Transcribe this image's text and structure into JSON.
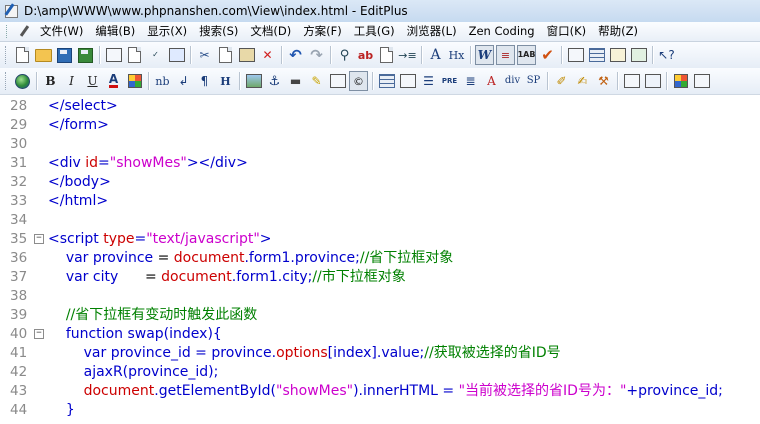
{
  "window": {
    "title": "D:\\amp\\WWW\\www.phpnanshen.com\\View\\index.html - EditPlus"
  },
  "menu": [
    "文件(W)",
    "编辑(B)",
    "显示(X)",
    "搜索(S)",
    "文档(D)",
    "方案(F)",
    "工具(G)",
    "浏览器(L)",
    "Zen Coding",
    "窗口(K)",
    "帮助(Z)"
  ],
  "toolbar2_text": {
    "bold": "B",
    "italic": "I",
    "underline": "U",
    "font_color": "A",
    "nbsp": "nb",
    "para": "¶",
    "heading": "H",
    "pre": "PRE",
    "div": "div",
    "span": "SP",
    "a_size": "A",
    "hx": "Hx",
    "w": "W"
  },
  "editor": {
    "lines": [
      {
        "n": "28",
        "fold": "",
        "tokens": [
          {
            "c": "tag",
            "t": "</select>"
          }
        ]
      },
      {
        "n": "29",
        "fold": "",
        "tokens": [
          {
            "c": "tag",
            "t": "</form>"
          }
        ]
      },
      {
        "n": "30",
        "fold": "",
        "tokens": []
      },
      {
        "n": "31",
        "fold": "",
        "tokens": [
          {
            "c": "tag",
            "t": "<div "
          },
          {
            "c": "attr",
            "t": "id"
          },
          {
            "c": "tag",
            "t": "="
          },
          {
            "c": "str",
            "t": "\"showMes\""
          },
          {
            "c": "tag",
            "t": "></div>"
          }
        ]
      },
      {
        "n": "32",
        "fold": "",
        "tokens": [
          {
            "c": "tag",
            "t": "</body>"
          }
        ]
      },
      {
        "n": "33",
        "fold": "",
        "tokens": [
          {
            "c": "tag",
            "t": "</html>"
          }
        ]
      },
      {
        "n": "34",
        "fold": "",
        "tokens": []
      },
      {
        "n": "35",
        "fold": "−",
        "tokens": [
          {
            "c": "tag",
            "t": "<script "
          },
          {
            "c": "attr",
            "t": "type"
          },
          {
            "c": "tag",
            "t": "="
          },
          {
            "c": "str",
            "t": "\"text/javascript\""
          },
          {
            "c": "tag",
            "t": ">"
          }
        ]
      },
      {
        "n": "36",
        "fold": "",
        "tokens": [
          {
            "c": "pl",
            "t": "    "
          },
          {
            "c": "kw",
            "t": "var"
          },
          {
            "c": "pl",
            "t": " "
          },
          {
            "c": "kw",
            "t": "province"
          },
          {
            "c": "pl",
            "t": " = "
          },
          {
            "c": "prop",
            "t": "document"
          },
          {
            "c": "kw",
            "t": ".form1.province;"
          },
          {
            "c": "cm",
            "t": "//省下拉框对象"
          }
        ]
      },
      {
        "n": "37",
        "fold": "",
        "tokens": [
          {
            "c": "pl",
            "t": "    "
          },
          {
            "c": "kw",
            "t": "var"
          },
          {
            "c": "pl",
            "t": " "
          },
          {
            "c": "kw",
            "t": "city"
          },
          {
            "c": "pl",
            "t": "      = "
          },
          {
            "c": "prop",
            "t": "document"
          },
          {
            "c": "kw",
            "t": ".form1.city;"
          },
          {
            "c": "cm",
            "t": "//市下拉框对象"
          }
        ]
      },
      {
        "n": "38",
        "fold": "",
        "tokens": []
      },
      {
        "n": "39",
        "fold": "",
        "tokens": [
          {
            "c": "pl",
            "t": "    "
          },
          {
            "c": "cm",
            "t": "//省下拉框有变动时触发此函数"
          }
        ]
      },
      {
        "n": "40",
        "fold": "−",
        "tokens": [
          {
            "c": "pl",
            "t": "    "
          },
          {
            "c": "kw",
            "t": "function"
          },
          {
            "c": "pl",
            "t": " "
          },
          {
            "c": "kw",
            "t": "swap(index){"
          }
        ]
      },
      {
        "n": "41",
        "fold": "",
        "tokens": [
          {
            "c": "pl",
            "t": "        "
          },
          {
            "c": "kw",
            "t": "var"
          },
          {
            "c": "pl",
            "t": " "
          },
          {
            "c": "kw",
            "t": "province_id = province."
          },
          {
            "c": "prop",
            "t": "options"
          },
          {
            "c": "kw",
            "t": "[index].value;"
          },
          {
            "c": "cm",
            "t": "//获取被选择的省ID号"
          }
        ]
      },
      {
        "n": "42",
        "fold": "",
        "tokens": [
          {
            "c": "pl",
            "t": "        "
          },
          {
            "c": "kw",
            "t": "ajaxR(province_id);"
          }
        ]
      },
      {
        "n": "43",
        "fold": "",
        "tokens": [
          {
            "c": "pl",
            "t": "        "
          },
          {
            "c": "prop",
            "t": "document"
          },
          {
            "c": "kw",
            "t": ".getElementById("
          },
          {
            "c": "str",
            "t": "\"showMes\""
          },
          {
            "c": "kw",
            "t": ").innerHTML = "
          },
          {
            "c": "str",
            "t": "\"当前被选择的省ID号为：\""
          },
          {
            "c": "kw",
            "t": "+province_id;"
          }
        ]
      },
      {
        "n": "44",
        "fold": "",
        "tokens": [
          {
            "c": "pl",
            "t": "    "
          },
          {
            "c": "kw",
            "t": "}"
          }
        ]
      }
    ]
  }
}
